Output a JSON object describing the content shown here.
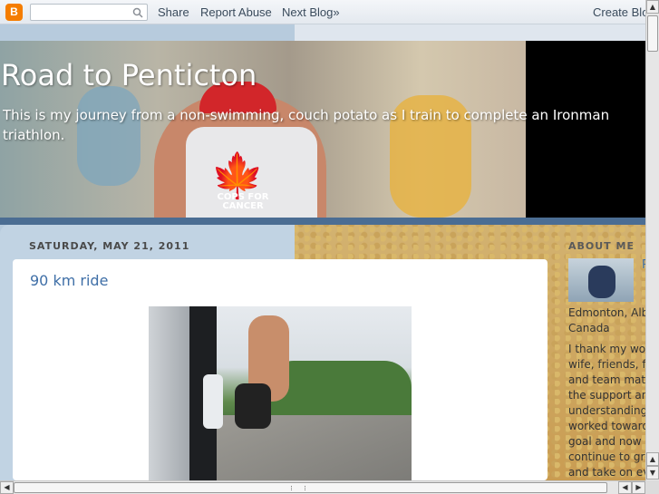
{
  "navbar": {
    "logo_letter": "B",
    "search_placeholder": "",
    "share_label": "Share",
    "report_label": "Report Abuse",
    "next_label": "Next Blog»",
    "create_label": "Create Blog"
  },
  "header": {
    "title": "Road to Penticton",
    "description": "This is my journey from a non-swimming, couch potato as I train to complete an Ironman triathlon.",
    "shirt_text": "COPS FOR CANCER"
  },
  "post": {
    "date": "SATURDAY, MAY 21, 2011",
    "title": "90 km ride"
  },
  "sidebar": {
    "heading": "ABOUT ME",
    "profile_name": "R",
    "location_lines": [
      "Edmonton, Alberta,",
      "Canada"
    ],
    "about_lines": [
      "I thank my wonderful",
      "wife, friends, family",
      "and team mates for",
      "the support and",
      "understanding as I",
      "worked towards this",
      "goal and now as I",
      "continue to grow",
      "and take on even"
    ]
  },
  "scrollbars": {
    "up_arrow": "▲",
    "down_arrow": "▼",
    "left_arrow": "◀",
    "right_arrow": "▶"
  }
}
